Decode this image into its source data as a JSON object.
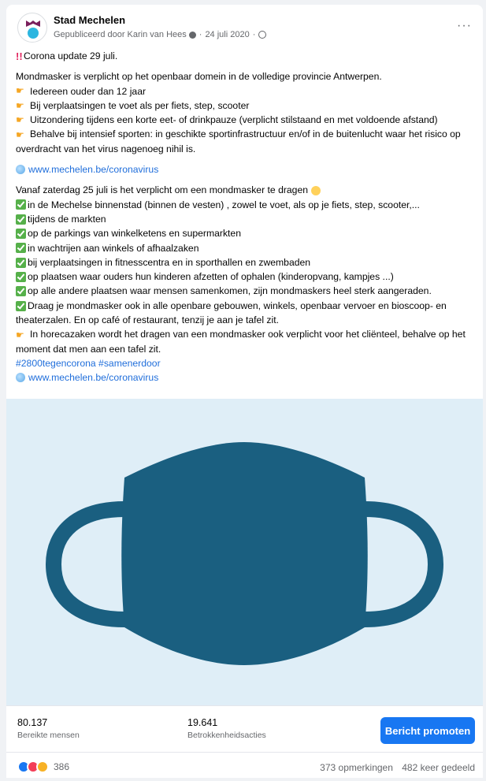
{
  "post": {
    "author": "Stad Mechelen",
    "published_by": "Gepubliceerd door Karin van Hees",
    "date": "24 juli 2020",
    "more_label": "···"
  },
  "content": {
    "title": "Corona update 29 juli.",
    "para1": "Mondmasker is verplicht op het openbaar domein in de volledige provincie Antwerpen.",
    "bullets1": [
      "Iedereen ouder dan 12 jaar",
      "Bij verplaatsingen te voet als per fiets, step, scooter",
      "Uitzondering tijdens een korte eet- of drinkpauze (verplicht stilstaand en met voldoende afstand)",
      "Behalve bij intensief sporten: in geschikte sportinfrastructuur en/of in de buitenlucht waar het risico op overdracht van het virus nagenoeg nihil is."
    ],
    "link1": "www.mechelen.be/coronavirus",
    "para2": "Vanaf zaterdag 25 juli is het verplicht om een mondmasker te dragen",
    "checks": [
      "in de Mechelse binnenstad (binnen de vesten) , zowel te voet, als op je fiets, step, scooter,...",
      "tijdens de markten",
      "op de parkings van winkelketens en supermarkten",
      "in wachtrijen aan winkels of afhaalzaken",
      "bij verplaatsingen in fitnesscentra en in sporthallen en zwembaden",
      "op plaatsen waar ouders hun kinderen afzetten of ophalen (kinderopvang, kampjes ...)",
      "op alle andere plaatsen waar mensen samenkomen, zijn mondmaskers heel sterk aangeraden.",
      "Draag je mondmasker ook in alle openbare gebouwen, winkels, openbaar vervoer en bioscoop- en theaterzalen. En op café of restaurant, tenzij je aan je tafel zit."
    ],
    "horeca": "In horecazaken wordt het dragen van een mondmasker ook verplicht voor het cliënteel, behalve op het moment dat men aan een tafel zit.",
    "hashtags": "#2800tegencorona #samenerdoor",
    "link2": "www.mechelen.be/coronavirus"
  },
  "image": {
    "subject": "face-mask-illustration",
    "background_color": "#dfeef7",
    "mask_color": "#1a5f80"
  },
  "stats": {
    "reach_value": "80.137",
    "reach_label": "Bereikte mensen",
    "engagement_value": "19.641",
    "engagement_label": "Betrokkenheidsacties",
    "promote_label": "Bericht promoten"
  },
  "footer": {
    "reaction_count": "386",
    "comments": "373 opmerkingen",
    "shares": "482 keer gedeeld"
  },
  "colors": {
    "accent": "#1877f2",
    "link": "#216fdb",
    "check": "#56b04a"
  }
}
